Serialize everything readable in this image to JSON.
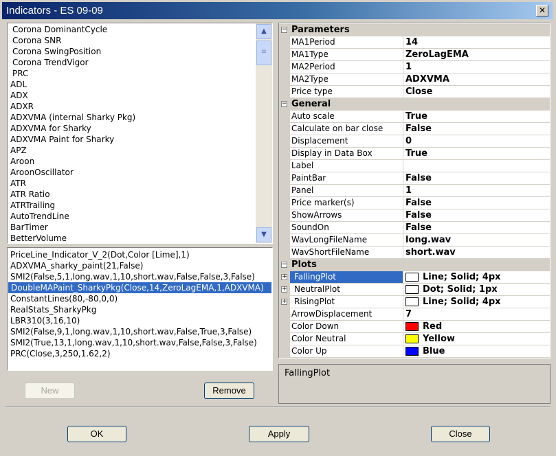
{
  "window": {
    "title": "Indicators - ES 09-09",
    "close_glyph": "✕"
  },
  "indicator_list": {
    "items": [
      {
        "label": "Corona DominantCycle",
        "indent": true
      },
      {
        "label": "Corona SNR",
        "indent": true
      },
      {
        "label": "Corona SwingPosition",
        "indent": true
      },
      {
        "label": "Corona TrendVigor",
        "indent": true
      },
      {
        "label": "PRC",
        "indent": true
      },
      {
        "label": "ADL",
        "indent": false
      },
      {
        "label": "ADX",
        "indent": false
      },
      {
        "label": "ADXR",
        "indent": false
      },
      {
        "label": "ADXVMA (internal Sharky Pkg)",
        "indent": false
      },
      {
        "label": "ADXVMA for Sharky",
        "indent": false
      },
      {
        "label": "ADXVMA Paint for Sharky",
        "indent": false
      },
      {
        "label": "APZ",
        "indent": false
      },
      {
        "label": "Aroon",
        "indent": false
      },
      {
        "label": "AroonOscillator",
        "indent": false
      },
      {
        "label": "ATR",
        "indent": false
      },
      {
        "label": "ATR Ratio",
        "indent": false
      },
      {
        "label": "ATRTrailing",
        "indent": false
      },
      {
        "label": "AutoTrendLine",
        "indent": false
      },
      {
        "label": "BarTimer",
        "indent": false
      },
      {
        "label": "BetterVolume",
        "indent": false
      }
    ]
  },
  "applied_list": {
    "items": [
      {
        "label": "PriceLine_Indicator_V_2(Dot,Color [Lime],1)",
        "selected": false
      },
      {
        "label": "ADXVMA_sharky_paint(21,False)",
        "selected": false
      },
      {
        "label": "SMI2(False,5,1,long.wav,1,10,short.wav,False,False,3,False)",
        "selected": false
      },
      {
        "label": "DoubleMAPaint_SharkyPkg(Close,14,ZeroLagEMA,1,ADXVMA)",
        "selected": true
      },
      {
        "label": "ConstantLines(80,-80,0,0)",
        "selected": false
      },
      {
        "label": "RealStats_SharkyPkg",
        "selected": false
      },
      {
        "label": "LBR310(3,16,10)",
        "selected": false
      },
      {
        "label": "SMI2(False,9,1,long.wav,1,10,short.wav,False,True,3,False)",
        "selected": false
      },
      {
        "label": "SMI2(True,13,1,long.wav,1,10,short.wav,False,False,3,False)",
        "selected": false
      },
      {
        "label": "PRC(Close,3,250,1.62,2)",
        "selected": false
      }
    ]
  },
  "buttons": {
    "new": "New",
    "remove": "Remove",
    "ok": "OK",
    "apply": "Apply",
    "close": "Close"
  },
  "properties": {
    "categories": [
      {
        "label": "Parameters",
        "rows": [
          {
            "name": "MA1Period",
            "value": "14"
          },
          {
            "name": "MA1Type",
            "value": "ZeroLagEMA"
          },
          {
            "name": "MA2Period",
            "value": "1"
          },
          {
            "name": "MA2Type",
            "value": "ADXVMA"
          },
          {
            "name": "Price type",
            "value": "Close"
          }
        ]
      },
      {
        "label": "General",
        "rows": [
          {
            "name": "Auto scale",
            "value": "True"
          },
          {
            "name": "Calculate on bar close",
            "value": "False"
          },
          {
            "name": "Displacement",
            "value": "0"
          },
          {
            "name": "Display in Data Box",
            "value": "True"
          },
          {
            "name": "Label",
            "value": ""
          },
          {
            "name": "PaintBar",
            "value": "False"
          },
          {
            "name": "Panel",
            "value": "1"
          },
          {
            "name": "Price marker(s)",
            "value": "False"
          },
          {
            "name": "ShowArrows",
            "value": "False"
          },
          {
            "name": "SoundOn",
            "value": "False"
          },
          {
            "name": "WavLongFileName",
            "value": "long.wav"
          },
          {
            "name": "WavShortFileName",
            "value": "short.wav"
          }
        ]
      },
      {
        "label": "Plots",
        "rows": [
          {
            "name": "FallingPlot",
            "value": "Line; Solid; 4px",
            "expandable": true,
            "swatch": "#ffffff",
            "selected": true
          },
          {
            "name": "NeutralPlot",
            "value": "Dot; Solid; 1px",
            "expandable": true,
            "swatch": "#ffffff"
          },
          {
            "name": "RisingPlot",
            "value": "Line; Solid; 4px",
            "expandable": true,
            "swatch": "#ffffff"
          },
          {
            "name": "ArrowDisplacement",
            "value": "7"
          },
          {
            "name": "Color Down",
            "value": "Red",
            "swatch": "#ff0000"
          },
          {
            "name": "Color Neutral",
            "value": "Yellow",
            "swatch": "#ffff00"
          },
          {
            "name": "Color Up",
            "value": "Blue",
            "swatch": "#0000ff"
          }
        ]
      }
    ]
  },
  "description": {
    "text": "FallingPlot"
  }
}
